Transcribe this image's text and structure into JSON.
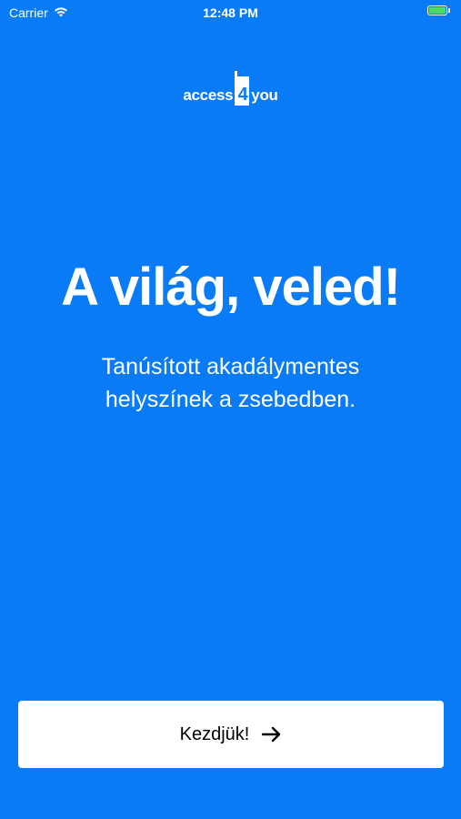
{
  "status_bar": {
    "carrier": "Carrier",
    "time": "12:48 PM",
    "battery_color": "#4CD964"
  },
  "logo": {
    "left_text": "access",
    "badge_text": "4",
    "right_text": "you"
  },
  "headline": "A világ, veled!",
  "subtitle": {
    "line1": "Tanúsított akadálymentes",
    "line2": "helyszínek a zsebedben."
  },
  "cta": {
    "label": "Kezdjük!",
    "icon": "arrow-right-icon"
  },
  "colors": {
    "background": "#0A7BF7",
    "button": "#FFFFFF"
  }
}
